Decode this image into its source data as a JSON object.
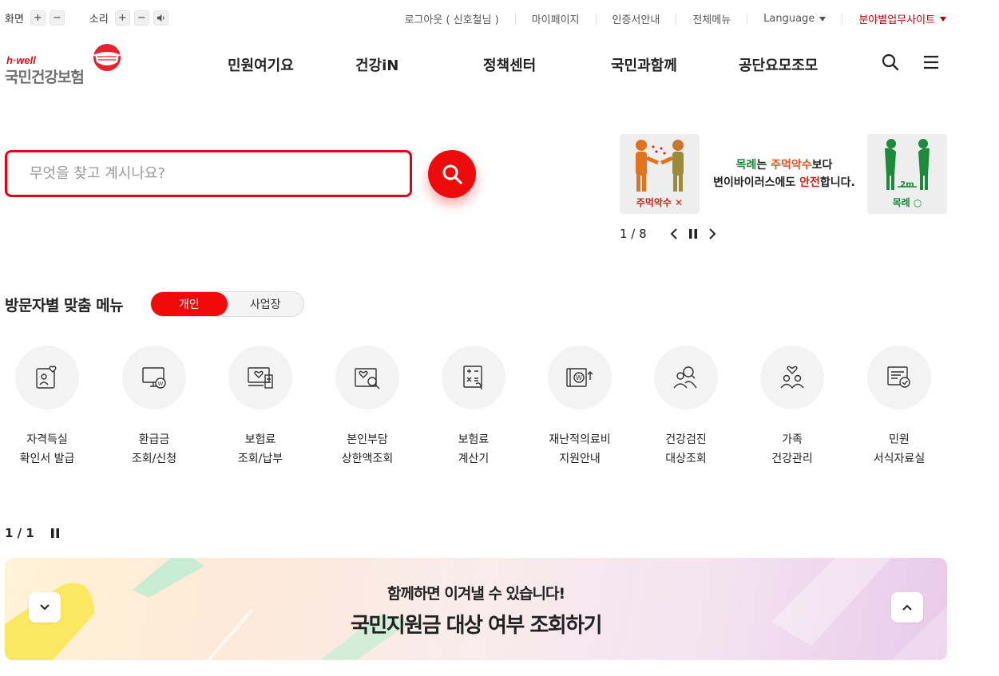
{
  "util": {
    "screen_label": "화면",
    "sound_label": "소리",
    "plus": "+",
    "minus": "−",
    "links": [
      "로그아웃 ( 신호철님 )",
      "마이페이지",
      "인증서안내",
      "전체메뉴",
      "Language",
      "분야별업무사이트"
    ]
  },
  "logo": {
    "hwell": "h·well",
    "name": "국민건강보험"
  },
  "gnb": {
    "items": [
      "민원여기요",
      "건강iN",
      "정책센터",
      "국민과함께",
      "공단요모조모"
    ]
  },
  "search": {
    "placeholder": "무엇을 찾고 계시나요?"
  },
  "banner": {
    "line1_a": "목례",
    "line1_b": "는 ",
    "line1_c": "주먹악수",
    "line1_d": "보다",
    "line2_a": "변이바이러스에도 ",
    "line2_b": "안전",
    "line2_c": "합니다.",
    "img1_caption": "주먹악수 ✕",
    "img2_caption": "목례 ○",
    "distance": "2m",
    "pager": "1 / 8"
  },
  "visitor_menu": {
    "title": "방문자별 맞춤 메뉴",
    "toggle": [
      "개인",
      "사업장"
    ],
    "items": [
      {
        "line1": "자격득실",
        "line2": "확인서 발급",
        "icon": "id-card-heart-icon"
      },
      {
        "line1": "환급금",
        "line2": "조회/신청",
        "icon": "monitor-won-icon"
      },
      {
        "line1": "보험료",
        "line2": "조회/납부",
        "icon": "receipt-heart-icon"
      },
      {
        "line1": "본인부담",
        "line2": "상한액조회",
        "icon": "search-heart-icon"
      },
      {
        "line1": "보험료",
        "line2": "계산기",
        "icon": "calculator-icon"
      },
      {
        "line1": "재난적의료비",
        "line2": "지원안내",
        "icon": "wallet-won-icon"
      },
      {
        "line1": "건강검진",
        "line2": "대상조회",
        "icon": "people-search-icon"
      },
      {
        "line1": "가족",
        "line2": "건강관리",
        "icon": "family-heart-icon"
      },
      {
        "line1": "민원",
        "line2": "서식자료실",
        "icon": "document-check-icon"
      }
    ]
  },
  "bottom_pager": "1 / 1",
  "promo": {
    "sub": "함께하면 이겨낼 수 있습니다!",
    "main": "국민지원금 대상 여부 조회하기"
  },
  "colors": {
    "brand_red": "#e60012",
    "toggle_red": "#f20a0a",
    "site_link_red": "#b5000b",
    "green": "#1b8a3a"
  }
}
